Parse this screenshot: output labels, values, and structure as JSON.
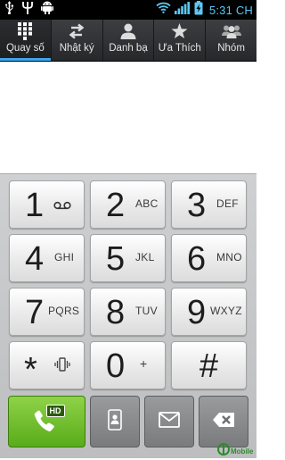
{
  "status_bar": {
    "time": "5:31 CH",
    "icons": [
      "usb-icon",
      "trident-icon",
      "android-icon",
      "wifi-icon",
      "signal-icon",
      "battery-charging-icon"
    ]
  },
  "tabs": [
    {
      "label": "Quay số",
      "icon": "dialpad-icon",
      "active": true
    },
    {
      "label": "Nhật ký",
      "icon": "call-log-icon",
      "active": false
    },
    {
      "label": "Danh bạ",
      "icon": "contacts-icon",
      "active": false
    },
    {
      "label": "Ưa Thích",
      "icon": "star-icon",
      "active": false
    },
    {
      "label": "Nhóm",
      "icon": "groups-icon",
      "active": false
    }
  ],
  "keypad": {
    "rows": [
      [
        {
          "digit": "1",
          "letters": "",
          "icon": "voicemail-icon"
        },
        {
          "digit": "2",
          "letters": "ABC"
        },
        {
          "digit": "3",
          "letters": "DEF"
        }
      ],
      [
        {
          "digit": "4",
          "letters": "GHI"
        },
        {
          "digit": "5",
          "letters": "JKL"
        },
        {
          "digit": "6",
          "letters": "MNO"
        }
      ],
      [
        {
          "digit": "7",
          "letters": "PQRS"
        },
        {
          "digit": "8",
          "letters": "TUV"
        },
        {
          "digit": "9",
          "letters": "WXYZ"
        }
      ],
      [
        {
          "digit": "*",
          "letters": "",
          "icon": "vibrate-icon"
        },
        {
          "digit": "0",
          "letters": "+"
        },
        {
          "digit": "#",
          "letters": ""
        }
      ]
    ],
    "hd_badge": "HD",
    "accent_call": "#6cbf2a",
    "accent_tab": "#3fa7ee"
  },
  "watermark": {
    "text": "Mobile"
  }
}
